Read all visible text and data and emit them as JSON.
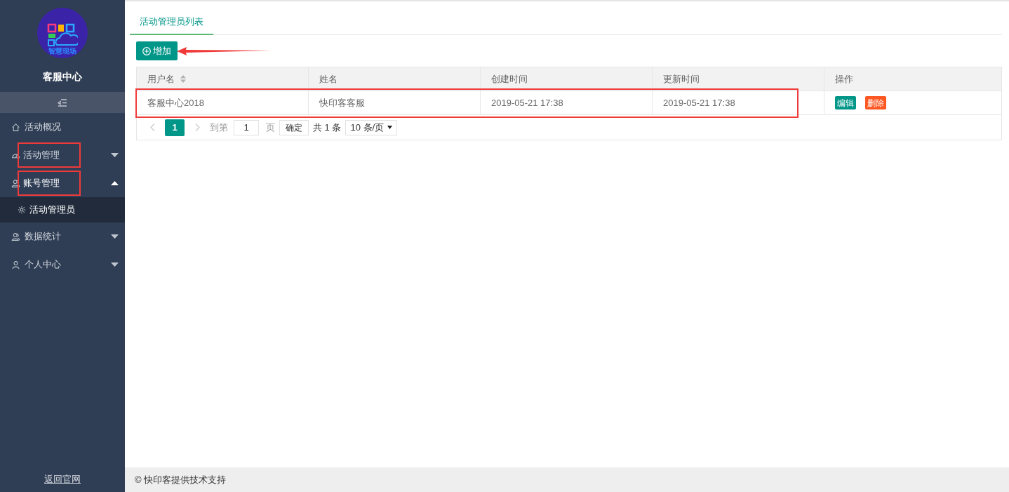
{
  "sidebar": {
    "logo_text": "智慧现场",
    "title": "客服中心",
    "items": [
      {
        "label": "活动概况",
        "kind": "link"
      },
      {
        "label": "活动管理",
        "kind": "group",
        "expanded": false,
        "highlighted": true
      },
      {
        "label": "账号管理",
        "kind": "group",
        "expanded": true,
        "highlighted": true,
        "children": [
          {
            "label": "活动管理员",
            "selected": true
          }
        ]
      },
      {
        "label": "数据统计",
        "kind": "group",
        "expanded": false,
        "highlighted": false
      },
      {
        "label": "个人中心",
        "kind": "group",
        "expanded": false,
        "highlighted": false
      }
    ],
    "footer_link": "返回官网"
  },
  "tabs": [
    {
      "label": "活动管理员列表",
      "selected": true
    }
  ],
  "add_button": "增加",
  "table": {
    "columns": [
      {
        "label": "用户名",
        "sortable": true
      },
      {
        "label": "姓名",
        "sortable": false
      },
      {
        "label": "创建时间",
        "sortable": false
      },
      {
        "label": "更新时间",
        "sortable": false
      },
      {
        "label": "操作",
        "sortable": false
      }
    ],
    "rows": [
      {
        "cells": [
          "客服中心2018",
          "快印客客服",
          "2019-05-21 17:38",
          "2019-05-21 17:38"
        ],
        "actions": [
          {
            "label": "编辑",
            "kind": "edit"
          },
          {
            "label": "删除",
            "kind": "delete"
          }
        ],
        "highlighted": true
      }
    ]
  },
  "pagination": {
    "pages": [
      {
        "label": "1",
        "selected": true
      }
    ],
    "goto_label": "到第",
    "goto_value": "1",
    "page_unit": "页",
    "confirm": "确定",
    "total": "共 1 条",
    "page_size": "10 条/页"
  },
  "footer": "© 快印客提供技术支持"
}
